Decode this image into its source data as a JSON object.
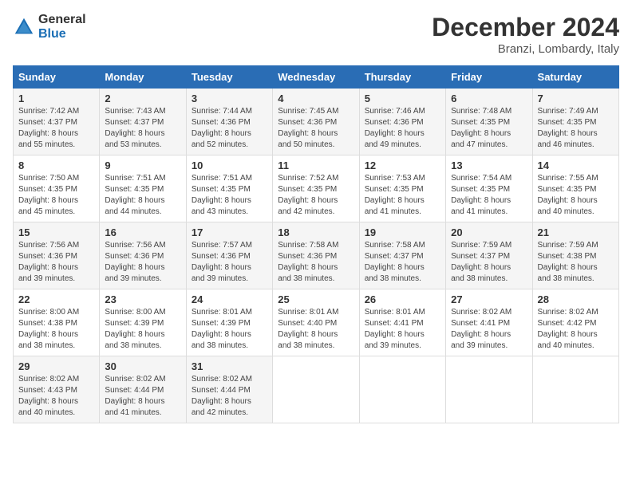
{
  "header": {
    "logo": {
      "general": "General",
      "blue": "Blue"
    },
    "title": "December 2024",
    "location": "Branzi, Lombardy, Italy"
  },
  "days_of_week": [
    "Sunday",
    "Monday",
    "Tuesday",
    "Wednesday",
    "Thursday",
    "Friday",
    "Saturday"
  ],
  "weeks": [
    [
      {
        "day": 1,
        "sunrise": "7:42 AM",
        "sunset": "4:37 PM",
        "daylight": "8 hours and 55 minutes."
      },
      {
        "day": 2,
        "sunrise": "7:43 AM",
        "sunset": "4:37 PM",
        "daylight": "8 hours and 53 minutes."
      },
      {
        "day": 3,
        "sunrise": "7:44 AM",
        "sunset": "4:36 PM",
        "daylight": "8 hours and 52 minutes."
      },
      {
        "day": 4,
        "sunrise": "7:45 AM",
        "sunset": "4:36 PM",
        "daylight": "8 hours and 50 minutes."
      },
      {
        "day": 5,
        "sunrise": "7:46 AM",
        "sunset": "4:36 PM",
        "daylight": "8 hours and 49 minutes."
      },
      {
        "day": 6,
        "sunrise": "7:48 AM",
        "sunset": "4:35 PM",
        "daylight": "8 hours and 47 minutes."
      },
      {
        "day": 7,
        "sunrise": "7:49 AM",
        "sunset": "4:35 PM",
        "daylight": "8 hours and 46 minutes."
      }
    ],
    [
      {
        "day": 8,
        "sunrise": "7:50 AM",
        "sunset": "4:35 PM",
        "daylight": "8 hours and 45 minutes."
      },
      {
        "day": 9,
        "sunrise": "7:51 AM",
        "sunset": "4:35 PM",
        "daylight": "8 hours and 44 minutes."
      },
      {
        "day": 10,
        "sunrise": "7:51 AM",
        "sunset": "4:35 PM",
        "daylight": "8 hours and 43 minutes."
      },
      {
        "day": 11,
        "sunrise": "7:52 AM",
        "sunset": "4:35 PM",
        "daylight": "8 hours and 42 minutes."
      },
      {
        "day": 12,
        "sunrise": "7:53 AM",
        "sunset": "4:35 PM",
        "daylight": "8 hours and 41 minutes."
      },
      {
        "day": 13,
        "sunrise": "7:54 AM",
        "sunset": "4:35 PM",
        "daylight": "8 hours and 41 minutes."
      },
      {
        "day": 14,
        "sunrise": "7:55 AM",
        "sunset": "4:35 PM",
        "daylight": "8 hours and 40 minutes."
      }
    ],
    [
      {
        "day": 15,
        "sunrise": "7:56 AM",
        "sunset": "4:36 PM",
        "daylight": "8 hours and 39 minutes."
      },
      {
        "day": 16,
        "sunrise": "7:56 AM",
        "sunset": "4:36 PM",
        "daylight": "8 hours and 39 minutes."
      },
      {
        "day": 17,
        "sunrise": "7:57 AM",
        "sunset": "4:36 PM",
        "daylight": "8 hours and 39 minutes."
      },
      {
        "day": 18,
        "sunrise": "7:58 AM",
        "sunset": "4:36 PM",
        "daylight": "8 hours and 38 minutes."
      },
      {
        "day": 19,
        "sunrise": "7:58 AM",
        "sunset": "4:37 PM",
        "daylight": "8 hours and 38 minutes."
      },
      {
        "day": 20,
        "sunrise": "7:59 AM",
        "sunset": "4:37 PM",
        "daylight": "8 hours and 38 minutes."
      },
      {
        "day": 21,
        "sunrise": "7:59 AM",
        "sunset": "4:38 PM",
        "daylight": "8 hours and 38 minutes."
      }
    ],
    [
      {
        "day": 22,
        "sunrise": "8:00 AM",
        "sunset": "4:38 PM",
        "daylight": "8 hours and 38 minutes."
      },
      {
        "day": 23,
        "sunrise": "8:00 AM",
        "sunset": "4:39 PM",
        "daylight": "8 hours and 38 minutes."
      },
      {
        "day": 24,
        "sunrise": "8:01 AM",
        "sunset": "4:39 PM",
        "daylight": "8 hours and 38 minutes."
      },
      {
        "day": 25,
        "sunrise": "8:01 AM",
        "sunset": "4:40 PM",
        "daylight": "8 hours and 38 minutes."
      },
      {
        "day": 26,
        "sunrise": "8:01 AM",
        "sunset": "4:41 PM",
        "daylight": "8 hours and 39 minutes."
      },
      {
        "day": 27,
        "sunrise": "8:02 AM",
        "sunset": "4:41 PM",
        "daylight": "8 hours and 39 minutes."
      },
      {
        "day": 28,
        "sunrise": "8:02 AM",
        "sunset": "4:42 PM",
        "daylight": "8 hours and 40 minutes."
      }
    ],
    [
      {
        "day": 29,
        "sunrise": "8:02 AM",
        "sunset": "4:43 PM",
        "daylight": "8 hours and 40 minutes."
      },
      {
        "day": 30,
        "sunrise": "8:02 AM",
        "sunset": "4:44 PM",
        "daylight": "8 hours and 41 minutes."
      },
      {
        "day": 31,
        "sunrise": "8:02 AM",
        "sunset": "4:44 PM",
        "daylight": "8 hours and 42 minutes."
      },
      null,
      null,
      null,
      null
    ]
  ]
}
